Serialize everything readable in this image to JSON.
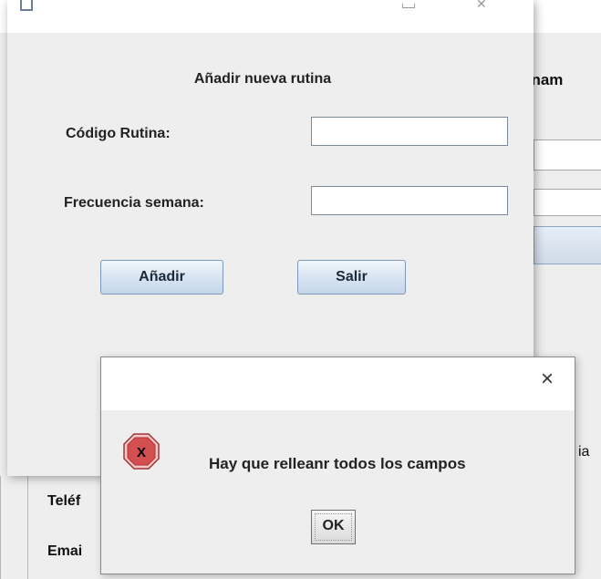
{
  "background_window": {
    "heading_fragment": "enam",
    "label_phone_fragment": "Teléf",
    "label_email_fragment": "Emai",
    "text_fragment": "ia"
  },
  "add_routine_dialog": {
    "title": "Añadir nueva rutina",
    "code_label": "Código Rutina:",
    "code_value": "",
    "frequency_label": "Frecuencia semana:",
    "frequency_value": "",
    "add_button": "Añadir",
    "exit_button": "Salir"
  },
  "error_dialog": {
    "message": "Hay que relleanr todos los campos",
    "ok_button": "OK",
    "close_glyph": "×"
  }
}
